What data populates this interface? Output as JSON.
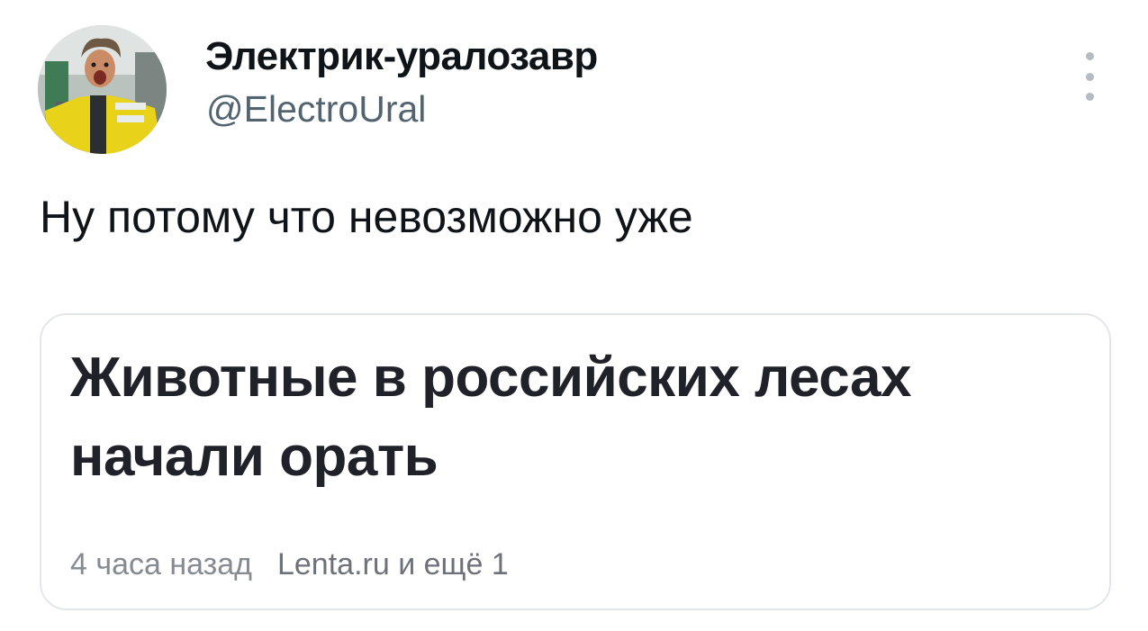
{
  "author": {
    "display_name": "Электрик-уралозавр",
    "handle": "@ElectroUral",
    "avatar_icon": "profile-photo"
  },
  "menu": {
    "icon": "more-vertical-icon"
  },
  "tweet": {
    "text": "Ну потому что невозможно уже"
  },
  "card": {
    "title": "Животные в российских лесах начали орать",
    "time": "4 часа назад",
    "source": "Lenta.ru и ещё 1"
  },
  "colors": {
    "text_primary": "#0f1419",
    "text_secondary": "#536471",
    "card_border": "#e4e7ea",
    "card_meta": "#868b93"
  }
}
